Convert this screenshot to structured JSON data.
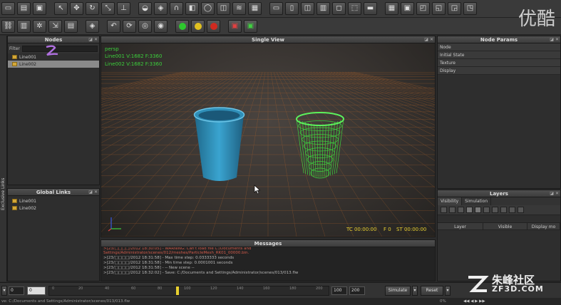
{
  "watermark_top": "优酷",
  "watermark_bottom": "朱峰社区",
  "watermark_sub": "ZF3D.COM",
  "nodes_panel": {
    "title": "Nodes",
    "filter_label": "Filter",
    "items": [
      "Line001",
      "Line002"
    ]
  },
  "exclusive_links_label": "Exclusive Links",
  "global_links": {
    "title": "Global Links",
    "items": [
      "Line001",
      "Line002"
    ]
  },
  "viewport": {
    "title": "Single View",
    "camera": "persp",
    "stats": [
      "Line001 V:1682 F:3360",
      "Line002 V:1682 F:3360"
    ],
    "tc": "TC 00:00:00",
    "frame": "F 0",
    "st": "ST 00:00:00"
  },
  "node_params": {
    "title": "Node Params",
    "rows": [
      "Node",
      "Initial State",
      "Texture",
      "Display"
    ]
  },
  "layers": {
    "title": "Layers",
    "tabs": [
      "Visibility",
      "Simulation"
    ],
    "columns": [
      "Layer",
      "Visible",
      "Display mo"
    ]
  },
  "messages": {
    "title": "Messages",
    "lines": [
      ">[23/□□□□/2012 18:30:05] - WARNING: Can't load file C:/Documents and",
      "Settings/Administrator/scenes/012/meshes/ParticleMesh_RK01_00000.bin.",
      ">[23/□□□□/2012 18:31:58] - Max time step: 0.0333333 seconds",
      ">[23/□□□□/2012 18:31:58] - Min time step: 0.0001001 seconds",
      ">[23/□□□□/2012 18:31:58] - -- New scene --",
      ">[23/□□□□/2012 18:32:02] - Save: C:/Documents and Settings/Administrator/scenes/013/013.flw"
    ]
  },
  "timeline": {
    "start": "0",
    "current": "0",
    "ticks": [
      "0",
      "20",
      "40",
      "60",
      "80",
      "100",
      "120",
      "140",
      "160",
      "180",
      "200"
    ],
    "end_a": "100",
    "end_b": "200",
    "simulate_label": "Simulate",
    "reset_label": "Reset"
  },
  "status": {
    "path": "ve: C:/Documents and Settings/Administrator/scenes/013/013.flw",
    "percent": "0%"
  },
  "colors": {
    "cup_blue": "#2f8fb8",
    "wire_green": "#3ed03e",
    "grid_orange": "#b8662a"
  }
}
